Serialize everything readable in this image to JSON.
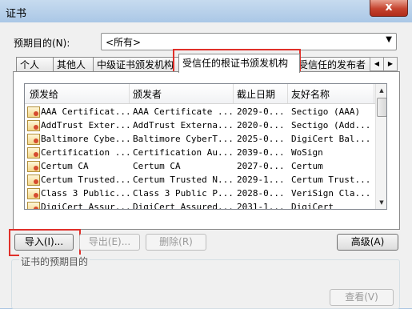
{
  "window": {
    "title": "证书",
    "close_label": "x"
  },
  "purpose": {
    "label": "预期目的(N):",
    "value": "<所有>"
  },
  "tabs": [
    {
      "label": "个人"
    },
    {
      "label": "其他人"
    },
    {
      "label": "中级证书颁发机构"
    },
    {
      "label": "受信任的根证书颁发机构"
    },
    {
      "label": "受信任的发布者"
    }
  ],
  "columns": [
    "颁发给",
    "颁发者",
    "截止日期",
    "友好名称"
  ],
  "rows": [
    {
      "issued_to": "AAA Certificat...",
      "issuer": "AAA Certificate ...",
      "expires": "2029-0...",
      "friendly": "Sectigo (AAA)"
    },
    {
      "issued_to": "AddTrust Exter...",
      "issuer": "AddTrust Externa...",
      "expires": "2020-0...",
      "friendly": "Sectigo (Add..."
    },
    {
      "issued_to": "Baltimore Cybe...",
      "issuer": "Baltimore CyberT...",
      "expires": "2025-0...",
      "friendly": "DigiCert Bal..."
    },
    {
      "issued_to": "Certification ...",
      "issuer": "Certification Au...",
      "expires": "2039-0...",
      "friendly": "WoSign"
    },
    {
      "issued_to": "Certum CA",
      "issuer": "Certum CA",
      "expires": "2027-0...",
      "friendly": "Certum"
    },
    {
      "issued_to": "Certum Trusted...",
      "issuer": "Certum Trusted N...",
      "expires": "2029-1...",
      "friendly": "Certum Trust..."
    },
    {
      "issued_to": "Class 3 Public...",
      "issuer": "Class 3 Public P...",
      "expires": "2028-0...",
      "friendly": "VeriSign Cla..."
    },
    {
      "issued_to": "DigiCert Assur...",
      "issuer": "DigiCert Assured...",
      "expires": "2031-1...",
      "friendly": "DigiCert"
    }
  ],
  "buttons": {
    "import": "导入(I)...",
    "export": "导出(E)...",
    "remove": "删除(R)",
    "advanced": "高级(A)",
    "view": "查看(V)"
  },
  "purposes_group": {
    "title": "证书的预期目的"
  },
  "icons": {
    "cert": "certificate-icon",
    "close": "close-icon",
    "dropdown": "chevron-down-icon"
  },
  "colors": {
    "highlight": "#e0302a",
    "titlebar": "#aac7e6"
  }
}
